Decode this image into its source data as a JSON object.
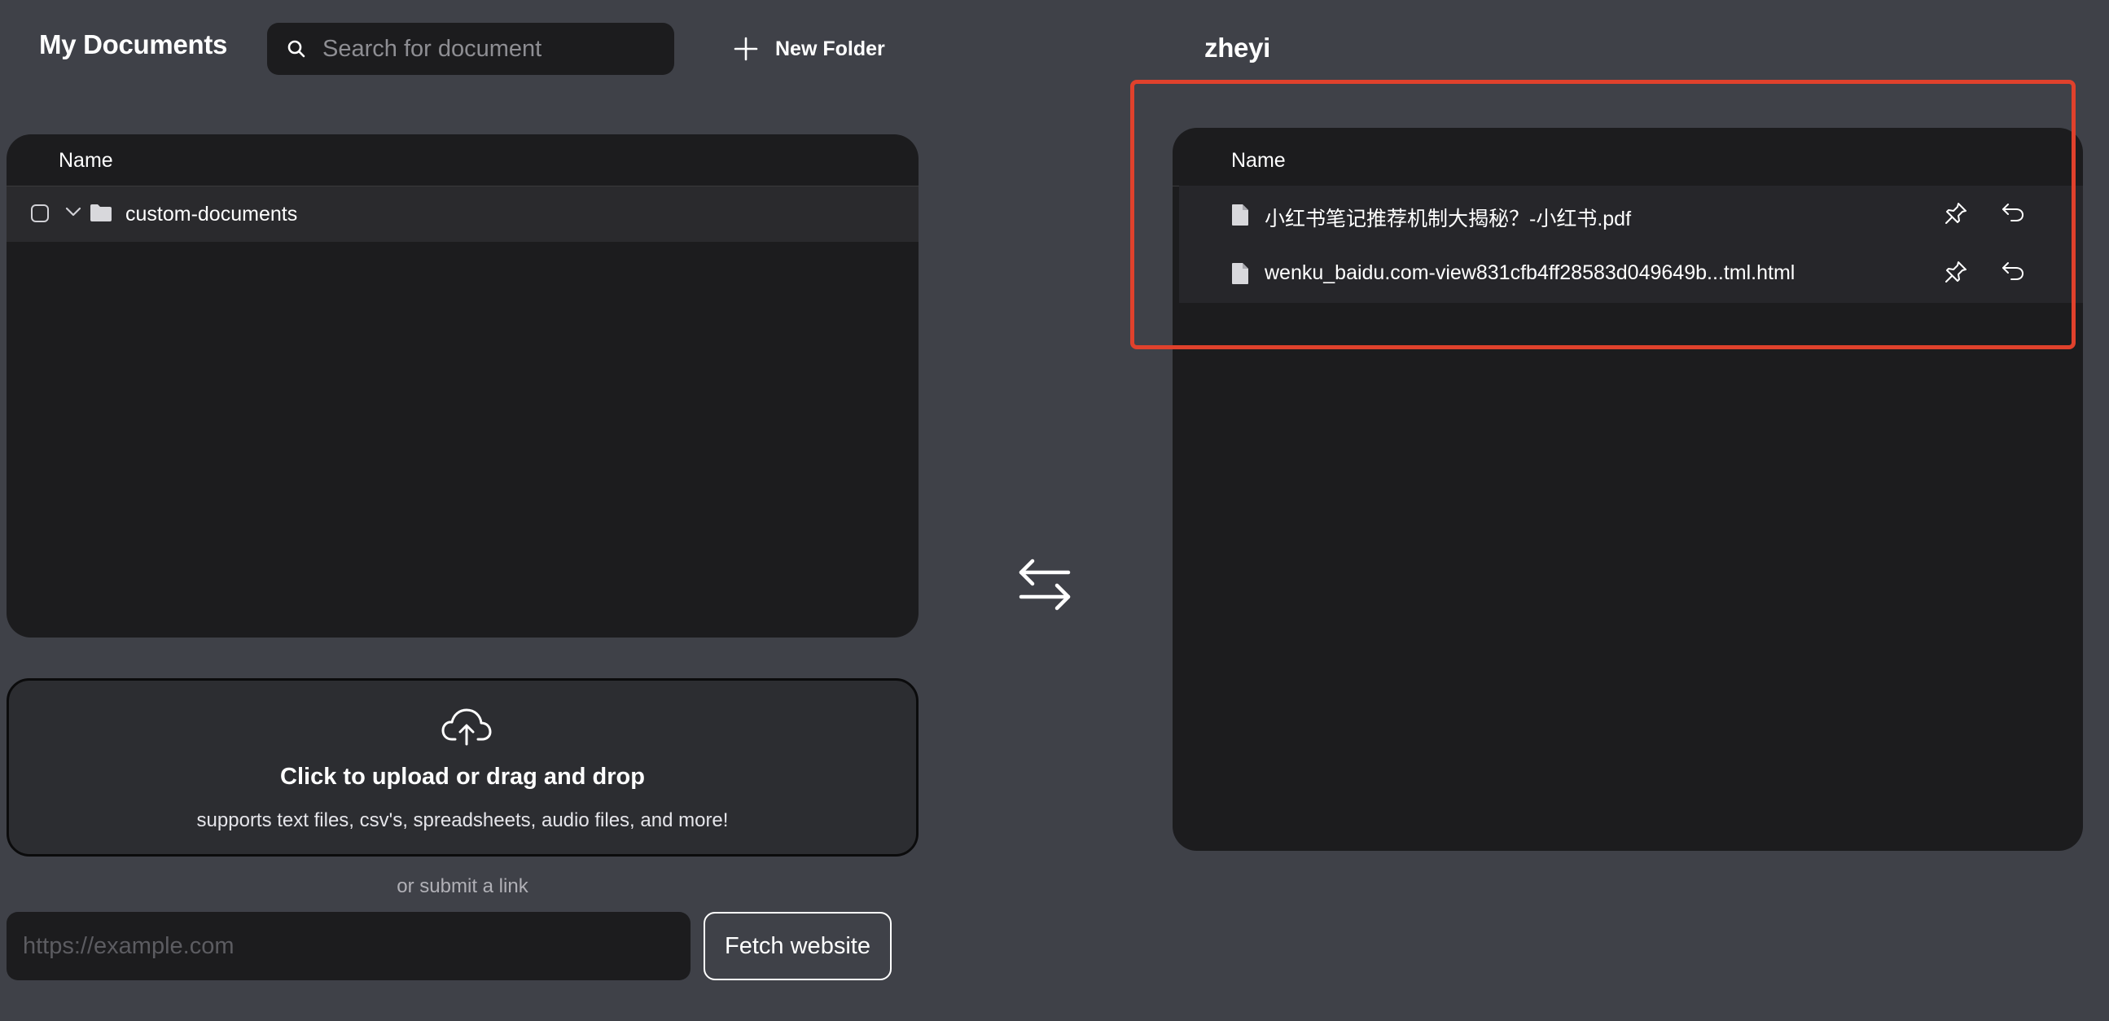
{
  "header": {
    "title": "My Documents",
    "search_placeholder": "Search for document",
    "new_folder_label": "New Folder"
  },
  "documents_table": {
    "column_name": "Name",
    "rows": [
      {
        "type": "folder",
        "name": "custom-documents",
        "expanded": false,
        "checked": false
      }
    ]
  },
  "upload": {
    "title": "Click to upload or drag and drop",
    "subtitle": "supports text files, csv's, spreadsheets, audio files, and more!",
    "or_link_text": "or submit a link",
    "url_placeholder": "https://example.com",
    "fetch_button_label": "Fetch website"
  },
  "workspace": {
    "name": "zheyi",
    "column_name": "Name",
    "documents": [
      {
        "name": "小红书笔记推荐机制大揭秘？-小红书.pdf",
        "icon": "file-icon"
      },
      {
        "name": "wenku_baidu.com-view831cfb4ff28583d049649b...tml.html",
        "icon": "file-icon"
      }
    ]
  },
  "colors": {
    "background": "#3f4148",
    "panel": "#1c1c1e",
    "highlight": "#e0412c",
    "text": "#ffffff"
  }
}
